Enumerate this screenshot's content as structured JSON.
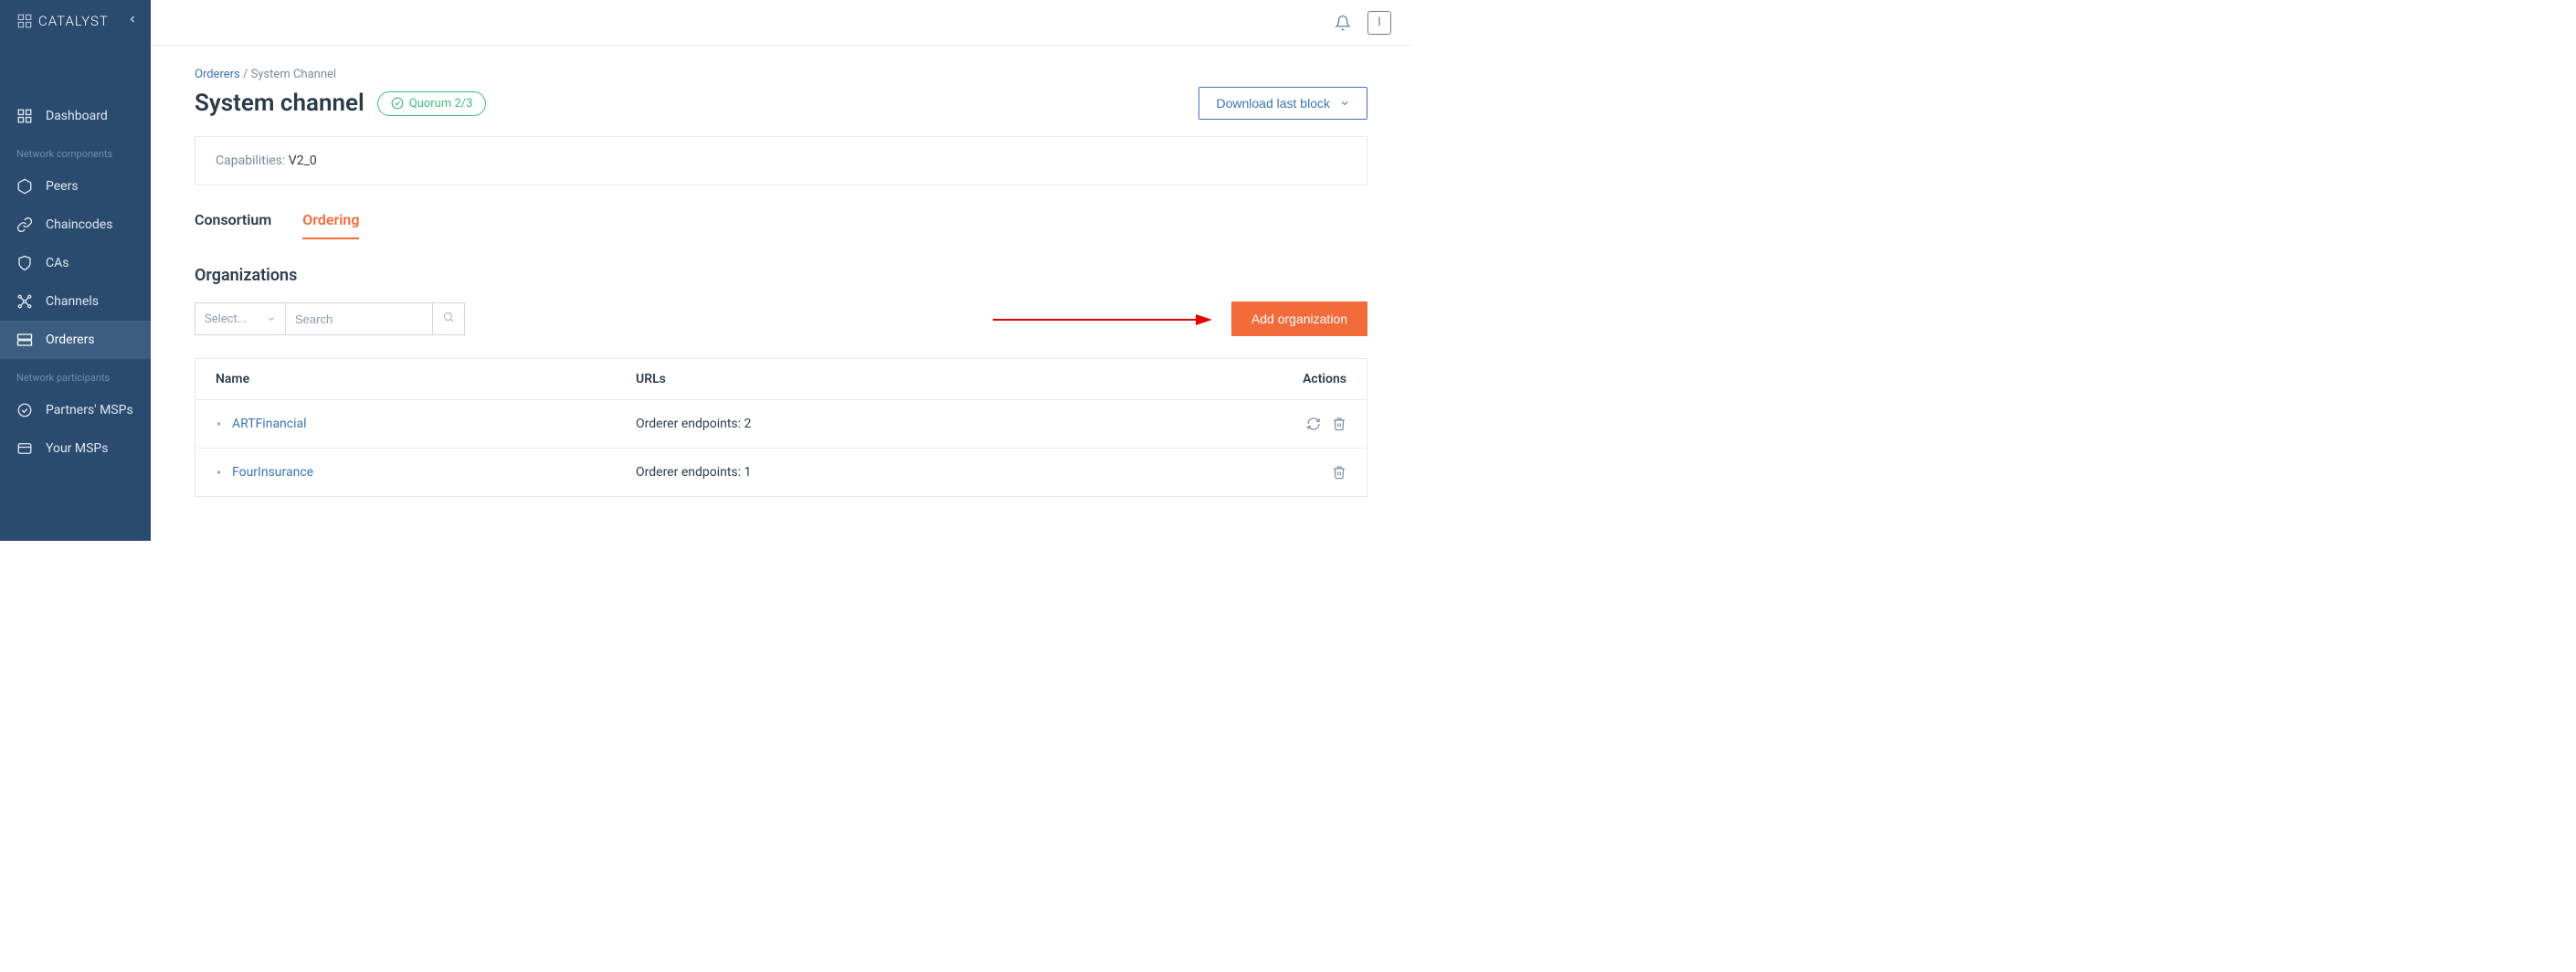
{
  "logo": "CATALYST",
  "sidebar": {
    "items": [
      {
        "label": "Dashboard"
      }
    ],
    "section1_label": "Network components",
    "section1_items": [
      {
        "label": "Peers"
      },
      {
        "label": "Chaincodes"
      },
      {
        "label": "CAs"
      },
      {
        "label": "Channels"
      },
      {
        "label": "Orderers"
      }
    ],
    "section2_label": "Network participants",
    "section2_items": [
      {
        "label": "Partners' MSPs"
      },
      {
        "label": "Your MSPs"
      }
    ]
  },
  "topbar": {
    "user_initial": "I"
  },
  "breadcrumb": {
    "parent": "Orderers",
    "sep": "/",
    "current": "System Channel"
  },
  "page": {
    "title": "System channel",
    "badge": "Quorum 2/3",
    "download_label": "Download last block"
  },
  "info": {
    "cap_label": "Capabilities:",
    "cap_value": "V2_0"
  },
  "tabs": {
    "t0": "Consortium",
    "t1": "Ordering"
  },
  "section_title": "Organizations",
  "filters": {
    "select_placeholder": "Select...",
    "search_placeholder": "Search"
  },
  "add_button": "Add organization",
  "table": {
    "head": {
      "name": "Name",
      "urls": "URLs",
      "actions": "Actions"
    },
    "rows": [
      {
        "name": "ARTFinancial",
        "urls": "Orderer endpoints: 2",
        "has_refresh": true
      },
      {
        "name": "FourInsurance",
        "urls": "Orderer endpoints: 1",
        "has_refresh": false
      }
    ]
  }
}
